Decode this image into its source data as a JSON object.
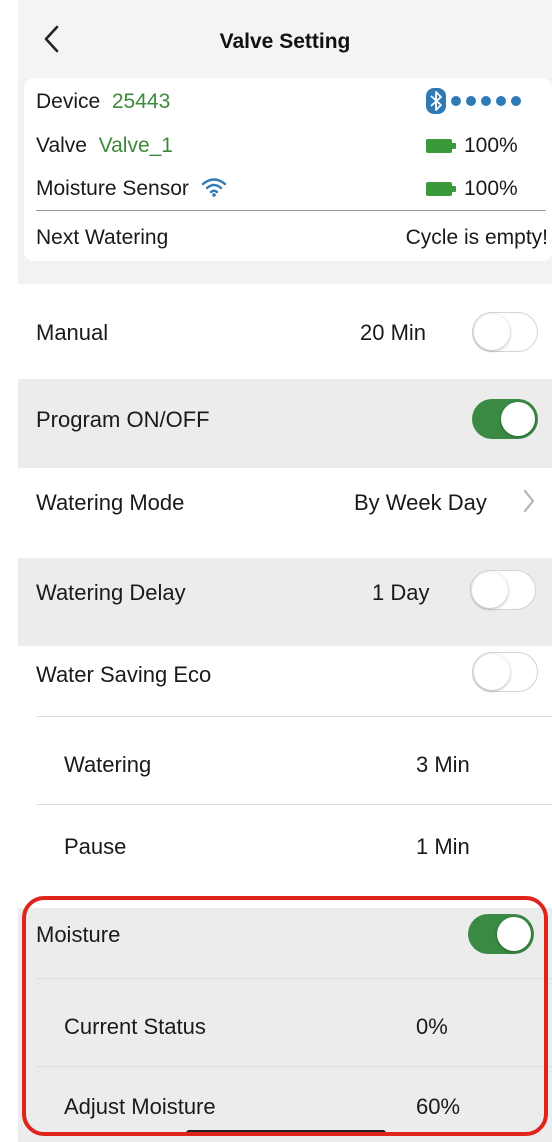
{
  "header": {
    "title": "Valve Setting"
  },
  "device_card": {
    "device_label": "Device",
    "device_value": "25443",
    "valve_label": "Valve",
    "valve_value": "Valve_1",
    "valve_battery": "100%",
    "sensor_label": "Moisture Sensor",
    "sensor_battery": "100%",
    "next_label": "Next Watering",
    "next_value": "Cycle is empty!"
  },
  "settings": {
    "manual": {
      "label": "Manual",
      "value": "20 Min",
      "toggle": false
    },
    "program": {
      "label": "Program ON/OFF",
      "toggle": true
    },
    "mode": {
      "label": "Watering Mode",
      "value": "By Week Day"
    },
    "delay": {
      "label": "Watering Delay",
      "value": "1 Day",
      "toggle": false
    },
    "eco": {
      "label": "Water Saving Eco",
      "toggle": false
    },
    "watering": {
      "label": "Watering",
      "value": "3 Min"
    },
    "pause": {
      "label": "Pause",
      "value": "1 Min"
    },
    "moisture": {
      "label": "Moisture",
      "toggle": true
    },
    "status": {
      "label": "Current Status",
      "value": "0%"
    },
    "adjust": {
      "label": "Adjust Moisture",
      "value": "60%"
    }
  },
  "colors": {
    "accent_green": "#3d8a3a",
    "toggle_on": "#3a8a44",
    "highlight": "#e0241c",
    "bluetooth": "#2f79b4"
  }
}
